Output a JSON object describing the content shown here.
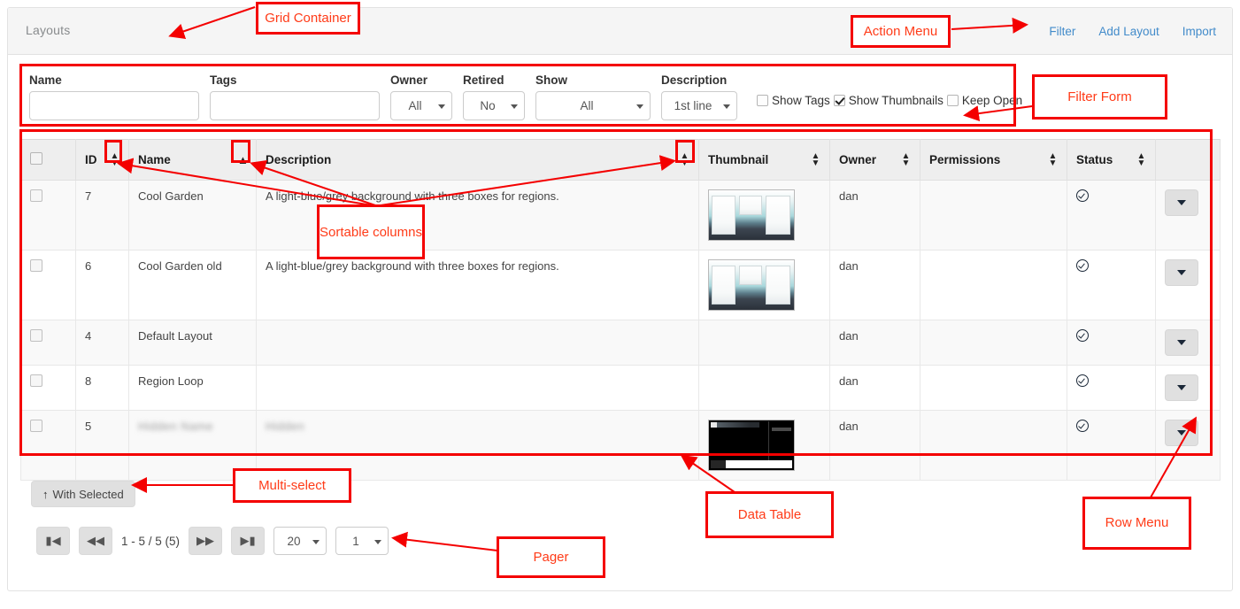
{
  "panel": {
    "title": "Layouts"
  },
  "action_menu": {
    "items": [
      {
        "label": "Filter",
        "name": "filter"
      },
      {
        "label": "Add Layout",
        "name": "add-layout"
      },
      {
        "label": "Import",
        "name": "import"
      }
    ]
  },
  "filter_form": {
    "fields": {
      "name": {
        "label": "Name",
        "value": "",
        "placeholder": ""
      },
      "tags": {
        "label": "Tags",
        "value": "",
        "placeholder": ""
      },
      "owner": {
        "label": "Owner",
        "value": "All"
      },
      "retired": {
        "label": "Retired",
        "value": "No"
      },
      "show": {
        "label": "Show",
        "value": "All"
      },
      "description": {
        "label": "Description",
        "value": "1st line"
      }
    },
    "checkboxes": [
      {
        "label": "Show Tags",
        "checked": false,
        "name": "show-tags"
      },
      {
        "label": "Show Thumbnails",
        "checked": true,
        "name": "show-thumbnails"
      },
      {
        "label": "Keep Open",
        "checked": false,
        "name": "keep-open"
      }
    ]
  },
  "table": {
    "columns": [
      {
        "label": "",
        "sort": "none"
      },
      {
        "label": "ID",
        "sort": "both"
      },
      {
        "label": "Name",
        "sort": "asc"
      },
      {
        "label": "Description",
        "sort": "both"
      },
      {
        "label": "Thumbnail",
        "sort": "both"
      },
      {
        "label": "Owner",
        "sort": "both"
      },
      {
        "label": "Permissions",
        "sort": "both"
      },
      {
        "label": "Status",
        "sort": "both"
      },
      {
        "label": "",
        "sort": "none"
      }
    ],
    "rows": [
      {
        "id": "7",
        "name": "Cool Garden",
        "description": "A light-blue/grey background with three boxes for regions.",
        "thumbnail": "garden",
        "owner": "dan",
        "permissions": "",
        "status": "enabled-icon",
        "redacted": false
      },
      {
        "id": "6",
        "name": "Cool Garden old",
        "description": "A light-blue/grey background with three boxes for regions.",
        "thumbnail": "garden",
        "owner": "dan",
        "permissions": "",
        "status": "enabled-icon",
        "redacted": false
      },
      {
        "id": "4",
        "name": "Default Layout",
        "description": "",
        "thumbnail": "none",
        "owner": "dan",
        "permissions": "",
        "status": "enabled-icon",
        "redacted": false
      },
      {
        "id": "8",
        "name": "Region Loop",
        "description": "",
        "thumbnail": "none",
        "owner": "dan",
        "permissions": "",
        "status": "enabled-icon",
        "redacted": false
      },
      {
        "id": "5",
        "name": "Hidden Name",
        "description": "Hidden",
        "thumbnail": "dark",
        "owner": "dan",
        "permissions": "",
        "status": "enabled-icon",
        "redacted": true
      }
    ]
  },
  "multiselect": {
    "label": "With Selected",
    "arrow": "↑"
  },
  "pager": {
    "first_label": "⏮",
    "prev_label": "⏪",
    "next_label": "⏩",
    "last_label": "⏭",
    "info": "1 - 5 / 5 (5)",
    "page_size": "20",
    "page_number": "1"
  },
  "annotations": [
    {
      "name": "grid-container",
      "label": "Grid Container"
    },
    {
      "name": "action-menu",
      "label": "Action Menu"
    },
    {
      "name": "filter-form",
      "label": "Filter Form"
    },
    {
      "name": "sortable-columns",
      "label": "Sortable columns"
    },
    {
      "name": "multi-select",
      "label": "Multi-select"
    },
    {
      "name": "data-table",
      "label": "Data Table"
    },
    {
      "name": "row-menu",
      "label": "Row Menu"
    },
    {
      "name": "pager",
      "label": "Pager"
    }
  ],
  "colors": {
    "accent_link": "#428bca",
    "annotation_red": "#f40000",
    "annotation_text": "#ff3b18",
    "header_bg": "#f5f5f5",
    "table_head_bg": "#eeeeee"
  }
}
